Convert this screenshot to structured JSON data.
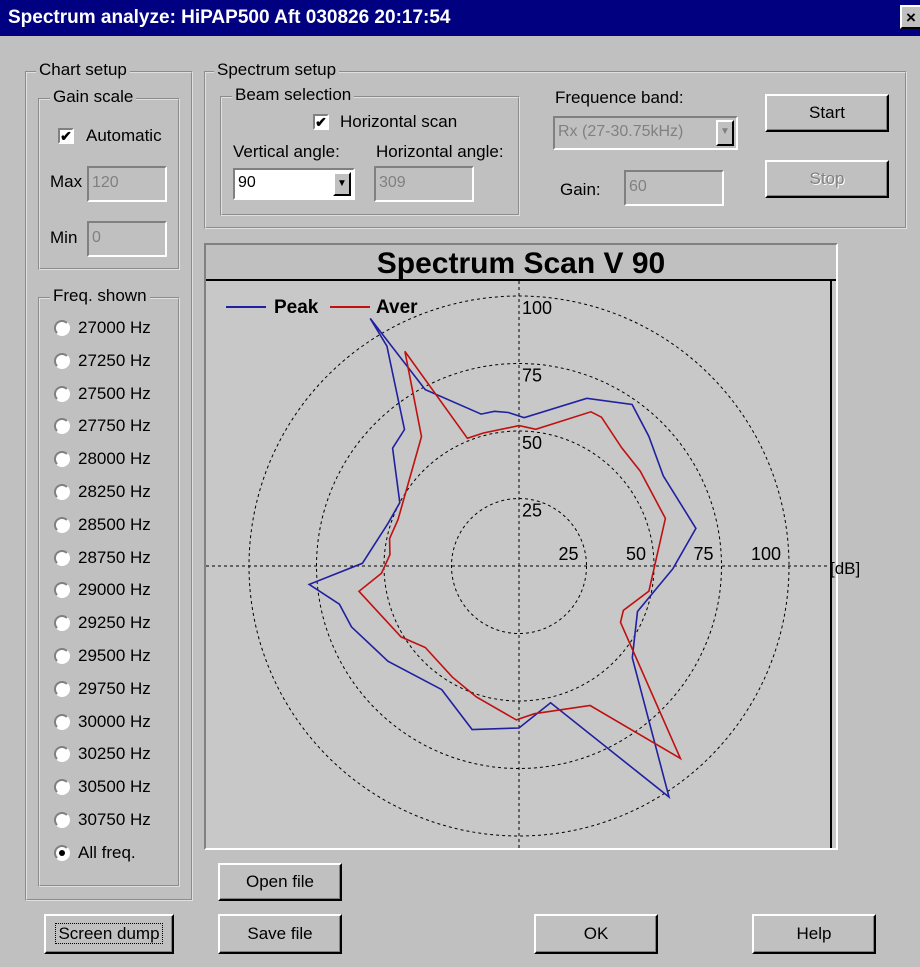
{
  "window": {
    "title": "Spectrum analyze:  HiPAP500 Aft 030826 20:17:54",
    "close_label": "×"
  },
  "chart_setup": {
    "label": "Chart setup",
    "gain_scale": {
      "label": "Gain scale",
      "automatic_label": "Automatic",
      "automatic_checked": true,
      "max_label": "Max",
      "max_value": "120",
      "min_label": "Min",
      "min_value": "0"
    },
    "freq_shown": {
      "label": "Freq. shown",
      "options": [
        "27000 Hz",
        "27250 Hz",
        "27500 Hz",
        "27750 Hz",
        "28000 Hz",
        "28250 Hz",
        "28500 Hz",
        "28750 Hz",
        "29000 Hz",
        "29250 Hz",
        "29500 Hz",
        "29750 Hz",
        "30000 Hz",
        "30250 Hz",
        "30500 Hz",
        "30750 Hz",
        "All freq."
      ],
      "selected": "All freq."
    }
  },
  "spectrum_setup": {
    "label": "Spectrum setup",
    "beam_selection": {
      "label": "Beam selection",
      "horizontal_scan_label": "Horizontal scan",
      "horizontal_scan_checked": true,
      "vertical_angle_label": "Vertical angle:",
      "vertical_angle_value": "90",
      "horizontal_angle_label": "Horizontal angle:",
      "horizontal_angle_value": "309"
    },
    "frequence_band_label": "Frequence band:",
    "frequence_band_value": "Rx (27-30.75kHz)",
    "gain_label": "Gain:",
    "gain_value": "60",
    "start_label": "Start",
    "stop_label": "Stop"
  },
  "buttons": {
    "open_file": "Open file",
    "save_file": "Save file",
    "screen_dump": "Screen dump",
    "ok": "OK",
    "help": "Help"
  },
  "chart_data": {
    "type": "polar",
    "title": "Spectrum Scan V 90",
    "unit_label": "[dB]",
    "rings": [
      25,
      50,
      75,
      100
    ],
    "rmax": 110,
    "grid": true,
    "legend": "top-left",
    "series": [
      {
        "name": "Peak",
        "color": "#2020a0",
        "points": [
          [
            107,
            -31
          ],
          [
            74,
            -28
          ],
          [
            58,
            -14
          ],
          [
            58,
            -9
          ],
          [
            57,
            -4
          ],
          [
            55,
            2
          ],
          [
            67,
            22
          ],
          [
            73,
            35
          ],
          [
            68,
            45
          ],
          [
            63,
            58
          ],
          [
            67,
            78
          ],
          [
            57,
            91
          ],
          [
            47,
            111
          ],
          [
            54,
            129
          ],
          [
            102,
            147
          ],
          [
            52,
            167
          ],
          [
            60,
            180
          ],
          [
            63,
            196
          ],
          [
            54,
            212
          ],
          [
            60,
            234
          ],
          [
            66,
            250
          ],
          [
            68,
            258
          ],
          [
            78,
            265
          ],
          [
            58,
            271
          ],
          [
            51,
            288
          ],
          [
            50,
            298
          ],
          [
            64,
            313
          ],
          [
            66,
            320
          ],
          [
            95,
            329
          ]
        ]
      },
      {
        "name": "Aver",
        "color": "#c01010",
        "points": [
          [
            90,
            -28
          ],
          [
            51,
            -22
          ],
          [
            51,
            -15
          ],
          [
            52,
            0
          ],
          [
            51,
            7
          ],
          [
            63,
            25
          ],
          [
            63,
            29
          ],
          [
            58,
            41
          ],
          [
            57,
            52
          ],
          [
            57,
            72
          ],
          [
            49,
            101
          ],
          [
            42,
            113
          ],
          [
            43,
            119
          ],
          [
            93,
            140
          ],
          [
            58,
            153
          ],
          [
            55,
            174
          ],
          [
            57,
            181
          ],
          [
            51,
            198
          ],
          [
            48,
            211
          ],
          [
            46,
            229
          ],
          [
            51,
            239
          ],
          [
            60,
            261
          ],
          [
            51,
            267
          ],
          [
            48,
            275
          ],
          [
            49,
            282
          ],
          [
            48,
            291
          ],
          [
            60,
            323
          ],
          [
            90,
            332
          ]
        ]
      }
    ]
  }
}
